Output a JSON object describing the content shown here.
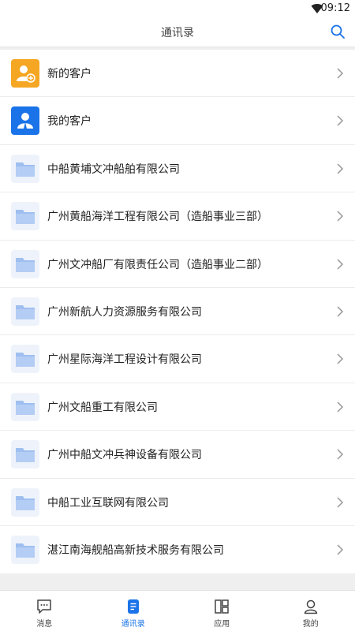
{
  "status": {
    "time": "09:12",
    "wifi_icon": "wifi-icon"
  },
  "header": {
    "title": "通讯录",
    "search_icon": "search-icon"
  },
  "list": [
    {
      "label": "新的客户",
      "icon": "add-user-icon",
      "icon_style": "orange"
    },
    {
      "label": "我的客户",
      "icon": "user-icon",
      "icon_style": "blue"
    },
    {
      "label": "中船黄埔文冲船舶有限公司",
      "icon": "folder-icon",
      "icon_style": "folder"
    },
    {
      "label": "广州黄船海洋工程有限公司（造船事业三部）",
      "icon": "folder-icon",
      "icon_style": "folder"
    },
    {
      "label": "广州文冲船厂有限责任公司（造船事业二部）",
      "icon": "folder-icon",
      "icon_style": "folder"
    },
    {
      "label": "广州新航人力资源服务有限公司",
      "icon": "folder-icon",
      "icon_style": "folder"
    },
    {
      "label": "广州星际海洋工程设计有限公司",
      "icon": "folder-icon",
      "icon_style": "folder"
    },
    {
      "label": "广州文船重工有限公司",
      "icon": "folder-icon",
      "icon_style": "folder"
    },
    {
      "label": "广州中船文冲兵神设备有限公司",
      "icon": "folder-icon",
      "icon_style": "folder"
    },
    {
      "label": "中船工业互联网有限公司",
      "icon": "folder-icon",
      "icon_style": "folder"
    },
    {
      "label": "湛江南海舰船高新技术服务有限公司",
      "icon": "folder-icon",
      "icon_style": "folder"
    }
  ],
  "tabs": [
    {
      "label": "消息",
      "icon": "message-icon",
      "active": false
    },
    {
      "label": "通讯录",
      "icon": "contacts-icon",
      "active": true
    },
    {
      "label": "应用",
      "icon": "apps-icon",
      "active": false
    },
    {
      "label": "我的",
      "icon": "profile-icon",
      "active": false
    }
  ],
  "colors": {
    "accent": "#1a73e8",
    "orange": "#f5a623",
    "folder": "#9fbff0"
  }
}
